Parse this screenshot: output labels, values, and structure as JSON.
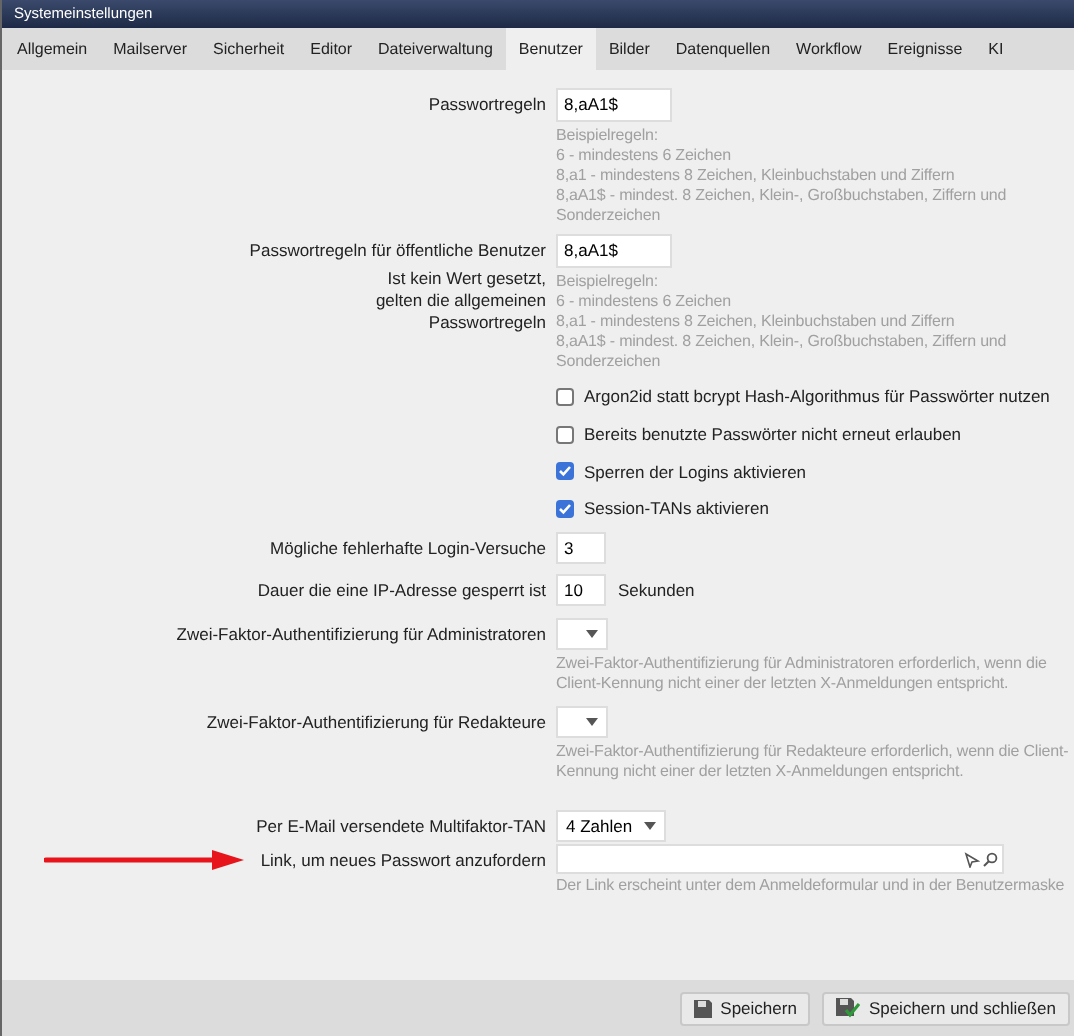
{
  "window": {
    "title": "Systemeinstellungen"
  },
  "tabs": [
    {
      "label": "Allgemein",
      "selected": false
    },
    {
      "label": "Mailserver",
      "selected": false
    },
    {
      "label": "Sicherheit",
      "selected": false
    },
    {
      "label": "Editor",
      "selected": false
    },
    {
      "label": "Dateiverwaltung",
      "selected": false
    },
    {
      "label": "Benutzer",
      "selected": true
    },
    {
      "label": "Bilder",
      "selected": false
    },
    {
      "label": "Datenquellen",
      "selected": false
    },
    {
      "label": "Workflow",
      "selected": false
    },
    {
      "label": "Ereignisse",
      "selected": false
    },
    {
      "label": "KI",
      "selected": false
    }
  ],
  "settings": [
    {
      "kind": "text",
      "label": "Passwortregeln",
      "value": "8,aA1$",
      "hint": [
        "Beispielregeln:",
        "6 - mindestens 6 Zeichen",
        "8,a1 - mindestens 8 Zeichen, Kleinbuchstaben und Ziffern",
        "8,aA1$ - mindest. 8 Zeichen, Klein-, Großbuchstaben, Ziffern und Sonderzeichen"
      ]
    },
    {
      "kind": "text",
      "label": "Passwortregeln für öffentliche Benutzer",
      "note": "Ist kein Wert gesetzt, gelten die allgemeinen Passwortregeln",
      "value": "8,aA1$",
      "hint": [
        "Beispielregeln:",
        "6 - mindestens 6 Zeichen",
        "8,a1 - mindestens 8 Zeichen, Kleinbuchstaben und Ziffern",
        "8,aA1$ - mindest. 8 Zeichen, Klein-, Großbuchstaben, Ziffern und Sonderzeichen"
      ]
    },
    {
      "kind": "checkbox",
      "label": "Argon2id statt bcrypt Hash-Algorithmus für Passwörter nutzen",
      "checked": false
    },
    {
      "kind": "checkbox",
      "label": "Bereits benutzte Passwörter nicht erneut erlauben",
      "checked": false
    },
    {
      "kind": "checkbox",
      "label": "Sperren der Logins aktivieren",
      "checked": true
    },
    {
      "kind": "checkbox",
      "label": "Session-TANs aktivieren",
      "checked": true
    },
    {
      "kind": "number",
      "label": "Mögliche fehlerhafte Login-Versuche",
      "value": "3"
    },
    {
      "kind": "number",
      "label": "Dauer die eine IP-Adresse gesperrt ist",
      "value": "10",
      "unit": "Sekunden"
    },
    {
      "kind": "select",
      "label": "Zwei-Faktor-Authentifizierung für Administratoren",
      "hint": [
        "Zwei-Faktor-Authentifizierung für Administratoren erforderlich, wenn die Client-Kennung nicht einer der letzten X-Anmeldungen entspricht."
      ]
    },
    {
      "kind": "select",
      "label": "Zwei-Faktor-Authentifizierung für Redakteure",
      "hint": [
        "Zwei-Faktor-Authentifizierung für Redakteure erforderlich, wenn die Client-Kennung nicht einer der letzten X-Anmeldungen entspricht."
      ]
    },
    {
      "kind": "select",
      "label": "Per E-Mail versendete Multifaktor-TAN",
      "value": "4 Zahlen"
    },
    {
      "kind": "link",
      "label": "Link, um neues Passwort anzufordern",
      "arrow": true,
      "hint": [
        "Der Link erscheint unter dem Anmeldeformular und in der Benutzermaske"
      ]
    }
  ],
  "buttons": [
    {
      "kind": "save",
      "label": "Speichern"
    },
    {
      "kind": "save_close",
      "label": "Speichern und schließen"
    }
  ]
}
